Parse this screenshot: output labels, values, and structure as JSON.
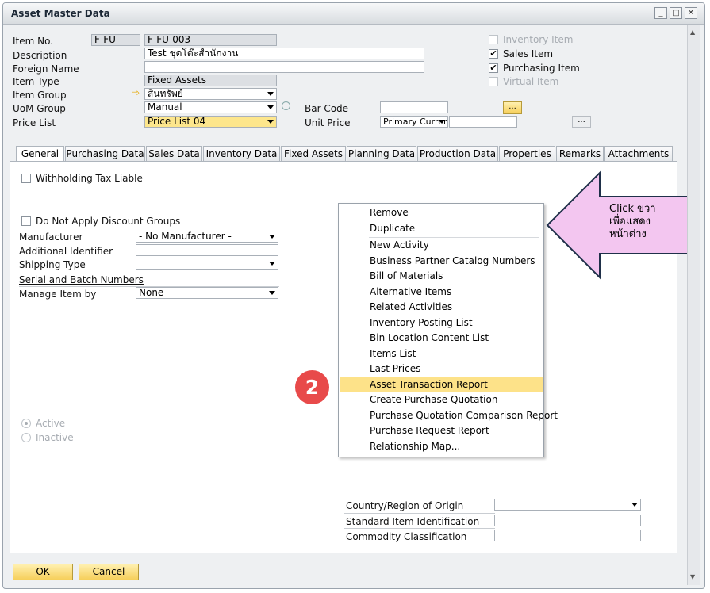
{
  "window": {
    "title": "Asset Master Data"
  },
  "header": {
    "item_no_label": "Item No.",
    "item_no_series": "F-FU",
    "item_no_value": "F-FU-003",
    "description_label": "Description",
    "description_value": "Test ชุดโต๊ะสำนักงาน",
    "foreign_name_label": "Foreign Name",
    "foreign_name_value": "",
    "item_type_label": "Item Type",
    "item_type_value": "Fixed Assets",
    "item_group_label": "Item Group",
    "item_group_value": "สินทรัพย์",
    "uom_group_label": "UoM Group",
    "uom_group_value": "Manual",
    "price_list_label": "Price List",
    "price_list_value": "Price List 04",
    "bar_code_label": "Bar Code",
    "bar_code_value": "",
    "unit_price_label": "Unit Price",
    "unit_price_currency": "Primary Curren",
    "unit_price_value": "",
    "more_button": "...",
    "inventory_item_label": "Inventory Item",
    "sales_item_label": "Sales Item",
    "purchasing_item_label": "Purchasing Item",
    "virtual_item_label": "Virtual Item",
    "sales_item_checked": "✔",
    "purchasing_item_checked": "✔"
  },
  "tabs": [
    "General",
    "Purchasing Data",
    "Sales Data",
    "Inventory Data",
    "Fixed Assets",
    "Planning Data",
    "Production Data",
    "Properties",
    "Remarks",
    "Attachments"
  ],
  "general": {
    "withholding_label": "Withholding Tax Liable",
    "no_discount_label": "Do Not Apply Discount Groups",
    "manufacturer_label": "Manufacturer",
    "manufacturer_value": "- No Manufacturer -",
    "additional_id_label": "Additional Identifier",
    "shipping_type_label": "Shipping Type",
    "serial_batch_label": "Serial and Batch Numbers",
    "manage_item_label": "Manage Item by",
    "manage_item_value": "None",
    "active_label": "Active",
    "inactive_label": "Inactive",
    "country_label": "Country/Region of Origin",
    "std_item_id_label": "Standard Item Identification",
    "commodity_label": "Commodity Classification"
  },
  "context_menu": {
    "items": [
      "Remove",
      "Duplicate",
      "New Activity",
      "Business Partner Catalog Numbers",
      "Bill of Materials",
      "Alternative Items",
      "Related Activities",
      "Inventory Posting List",
      "Bin Location Content List",
      "Items List",
      "Last Prices",
      "Asset Transaction Report",
      "Create Purchase Quotation",
      "Purchase Quotation Comparison Report",
      "Purchase Request Report",
      "Relationship Map..."
    ],
    "highlighted": "Asset Transaction Report"
  },
  "callout": {
    "line1": "Click ขวา",
    "line2": "เพื่อแสดง",
    "line3": "หน้าต่าง"
  },
  "step_badge": "2",
  "footer": {
    "ok": "OK",
    "cancel": "Cancel"
  },
  "colors": {
    "highlight": "#fde289",
    "badge": "#e84a4a",
    "callout": "#f3c6f0"
  }
}
